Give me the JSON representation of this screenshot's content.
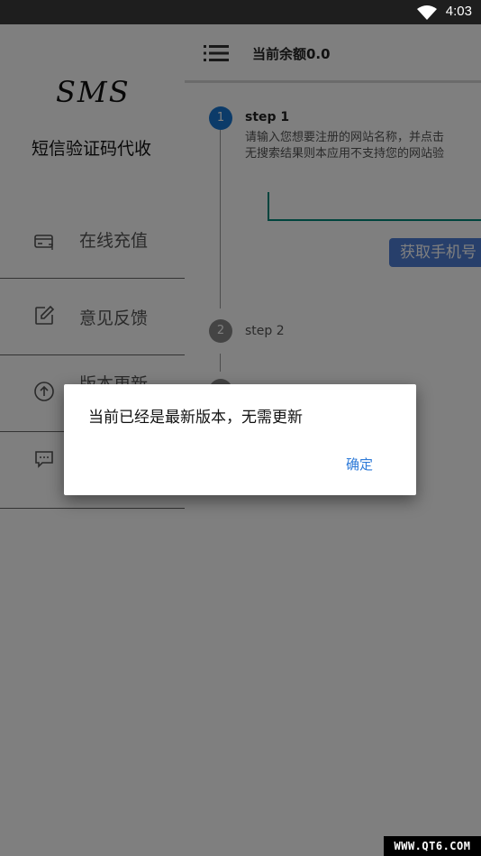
{
  "status_bar": {
    "time": "4:03",
    "wifi_icon": "wifi-icon"
  },
  "drawer": {
    "logo": "SMS",
    "subtitle": "短信验证码代收",
    "items": [
      {
        "label": "在线充值",
        "icon": "payment-card-icon"
      },
      {
        "label": "意见反馈",
        "icon": "edit-icon"
      },
      {
        "label": "版本更新",
        "icon": "upload-arrow-icon"
      },
      {
        "label": "",
        "icon": "message-icon"
      }
    ]
  },
  "main": {
    "toolbar": {
      "menu_icon": "list-menu-icon",
      "title": "当前余额0.0"
    },
    "steps": [
      {
        "number": "1",
        "title": "step 1",
        "desc": [
          "请输入您想要注册的网站名称，并点击",
          "无搜索结果则本应用不支持您的网站验"
        ]
      },
      {
        "number": "2",
        "title": "step 2"
      }
    ],
    "get_phone_label": "获取手机号"
  },
  "dialog": {
    "message": "当前已经是最新版本，无需更新",
    "ok_label": "确定"
  },
  "watermark": "WWW.QT6.COM",
  "colors": {
    "accent": "#2d7ad8",
    "step_active": "#1976d2",
    "step_inactive": "#888888",
    "input_underline": "#00897b",
    "button": "#4f7fd6"
  }
}
